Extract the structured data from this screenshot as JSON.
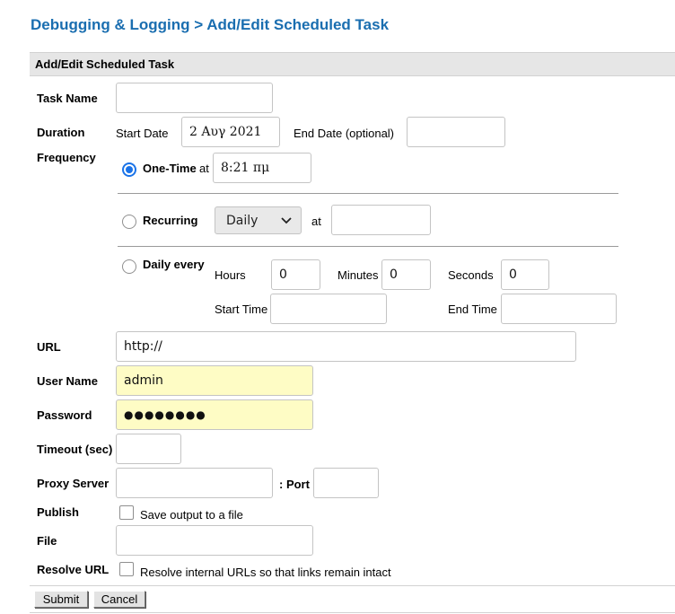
{
  "header": {
    "title": "Debugging & Logging > Add/Edit Scheduled Task"
  },
  "section": {
    "title": "Add/Edit Scheduled Task"
  },
  "task_name": {
    "label": "Task Name",
    "value": ""
  },
  "duration": {
    "label": "Duration",
    "start_label": "Start Date",
    "start_value": "2 Αυγ 2021",
    "end_label": "End Date (optional)",
    "end_value": ""
  },
  "frequency": {
    "label": "Frequency",
    "one_time": {
      "label": "One-Time",
      "at_label": "at",
      "time_value": "8:21 πμ",
      "selected": true
    },
    "recurring": {
      "label": "Recurring",
      "select_value": "Daily",
      "at_label": "at",
      "time_value": "",
      "selected": false
    },
    "daily_every": {
      "label": "Daily every",
      "selected": false,
      "hours_label": "Hours",
      "hours_value": "0",
      "minutes_label": "Minutes",
      "minutes_value": "0",
      "seconds_label": "Seconds",
      "seconds_value": "0",
      "start_time_label": "Start Time",
      "start_time_value": "",
      "end_time_label": "End Time",
      "end_time_value": ""
    }
  },
  "url": {
    "label": "URL",
    "value": "http://"
  },
  "user_name": {
    "label": "User Name",
    "value": "admin"
  },
  "password": {
    "label": "Password",
    "value": "●●●●●●●●"
  },
  "timeout": {
    "label": "Timeout (sec)",
    "value": ""
  },
  "proxy": {
    "label": "Proxy Server",
    "value": "",
    "port_label": ": Port",
    "port_value": ""
  },
  "publish": {
    "label": "Publish",
    "checkbox_label": "Save output to a file",
    "checked": false
  },
  "file": {
    "label": "File",
    "value": ""
  },
  "resolve_url": {
    "label": "Resolve URL",
    "checkbox_label": "Resolve internal URLs so that links remain intact",
    "checked": false
  },
  "buttons": {
    "submit": "Submit",
    "cancel": "Cancel"
  },
  "icons": {
    "select_arrow": "chevron-down-icon"
  },
  "colors": {
    "title": "#1a6eb0",
    "radio_selected": "#1a73e8",
    "autofill_bg": "#fefcc5",
    "section_bar": "#e6e6e6"
  }
}
